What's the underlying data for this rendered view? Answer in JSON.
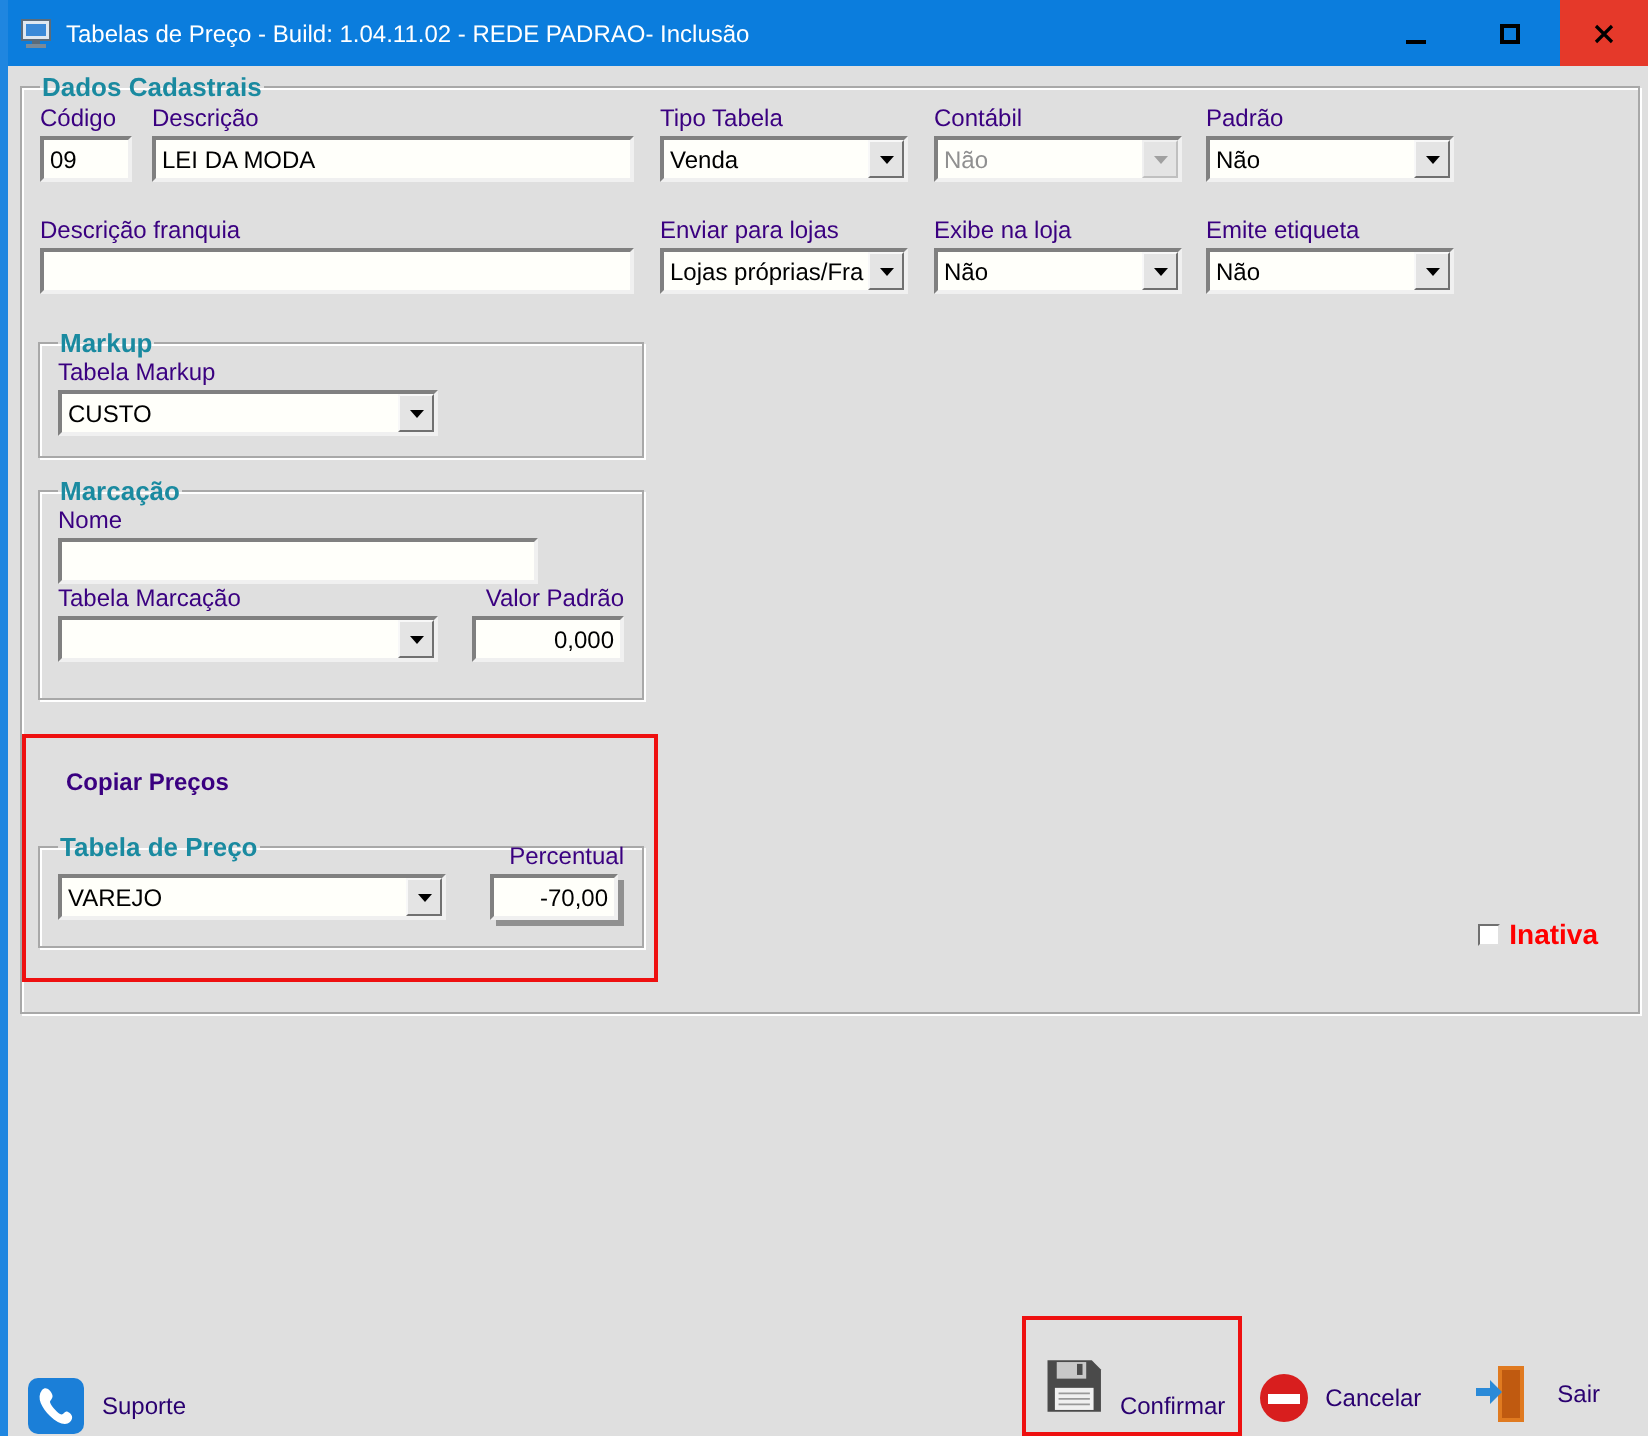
{
  "window": {
    "title": "Tabelas de Preço - Build: 1.04.11.02 - REDE PADRAO- Inclusão"
  },
  "dados_cadastrais": {
    "title": "Dados Cadastrais",
    "fields": [
      {
        "label": "Código",
        "kind": "text",
        "value": "09"
      },
      {
        "label": "Descrição",
        "kind": "text",
        "value": "LEI DA MODA"
      },
      {
        "label": "Tipo Tabela",
        "kind": "select",
        "value": "Venda",
        "disabled": false
      },
      {
        "label": "Contábil",
        "kind": "select",
        "value": "Não",
        "disabled": true
      },
      {
        "label": "Padrão",
        "kind": "select",
        "value": "Não",
        "disabled": false
      },
      {
        "label": "Descrição franquia",
        "kind": "text"
      },
      {
        "label": "Enviar para lojas",
        "kind": "select",
        "value": "Lojas próprias/Fra",
        "disabled": false
      },
      {
        "label": "Exibe na loja",
        "kind": "select",
        "value": "Não",
        "disabled": false
      },
      {
        "label": "Emite etiqueta",
        "kind": "select",
        "value": "Não",
        "disabled": false
      }
    ]
  },
  "markup": {
    "title": "Markup",
    "fields": [
      {
        "label": "Tabela Markup",
        "kind": "select",
        "value": "CUSTO",
        "disabled": false
      }
    ]
  },
  "marcacao": {
    "title": "Marcação",
    "fields": [
      {
        "label": "Nome",
        "kind": "text"
      },
      {
        "label": "Tabela Marcação",
        "kind": "select",
        "disabled": false
      },
      {
        "label": "Valor Padrão",
        "kind": "number",
        "value": "0,000"
      }
    ]
  },
  "copiar_precos": {
    "label": "Copiar Preços",
    "highlighted": true,
    "tabela_de_preco": {
      "title": "Tabela de Preço",
      "fields": [
        {
          "kind": "select",
          "value": "VAREJO",
          "disabled": false
        },
        {
          "label": "Percentual",
          "kind": "number",
          "value": "-70,00"
        }
      ]
    }
  },
  "inativa": {
    "label": "Inativa",
    "checked": false
  },
  "buttons": [
    {
      "kind": "support",
      "label": "Suporte",
      "highlighted": false
    },
    {
      "kind": "confirm",
      "label": "Confirmar",
      "highlighted": true
    },
    {
      "kind": "cancel",
      "label": "Cancelar",
      "highlighted": false
    },
    {
      "kind": "exit",
      "label": "Sair",
      "highlighted": false
    }
  ]
}
